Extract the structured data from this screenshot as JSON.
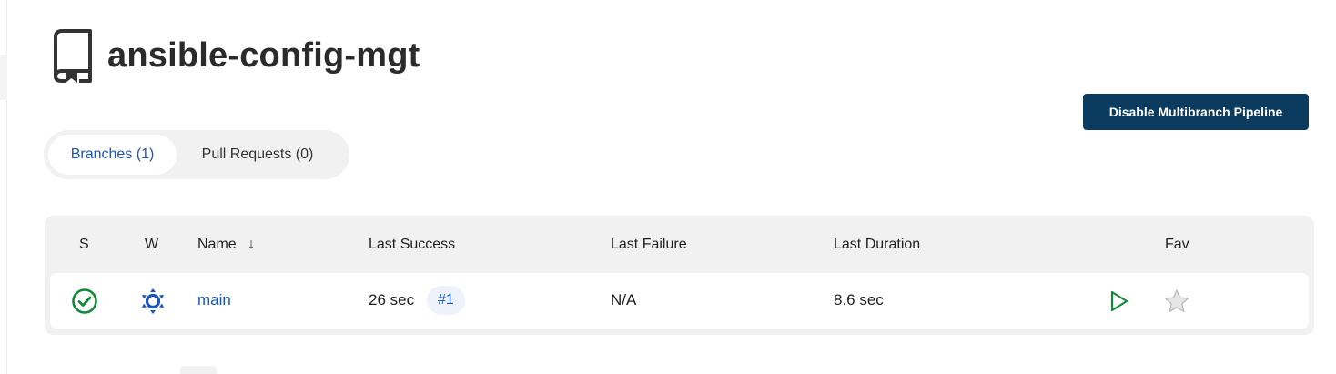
{
  "page": {
    "title": "ansible-config-mgt",
    "icons": {
      "repo": "repo-book-icon"
    }
  },
  "actions": {
    "disable_label": "Disable Multibranch Pipeline"
  },
  "tabs": [
    {
      "label": "Branches (1)",
      "active": true
    },
    {
      "label": "Pull Requests (0)",
      "active": false
    }
  ],
  "table": {
    "headers": {
      "s": "S",
      "w": "W",
      "name": "Name",
      "sort_indicator": "↓",
      "last_success": "Last Success",
      "last_failure": "Last Failure",
      "last_duration": "Last Duration",
      "fav": "Fav"
    },
    "rows": [
      {
        "status_icon": "success-check-icon",
        "weather_icon": "sunny-weather-icon",
        "name": "main",
        "last_success": "26 sec",
        "build": "#1",
        "last_failure": "N/A",
        "last_duration": "8.6 sec",
        "run_icon": "play-icon",
        "fav_icon": "star-icon"
      }
    ]
  },
  "colors": {
    "primary_button": "#0c3b60",
    "link": "#1a55b8",
    "success": "#138a3a",
    "weather": "#1a55b8",
    "run": "#138a3a",
    "star": "#c8c8c8"
  }
}
